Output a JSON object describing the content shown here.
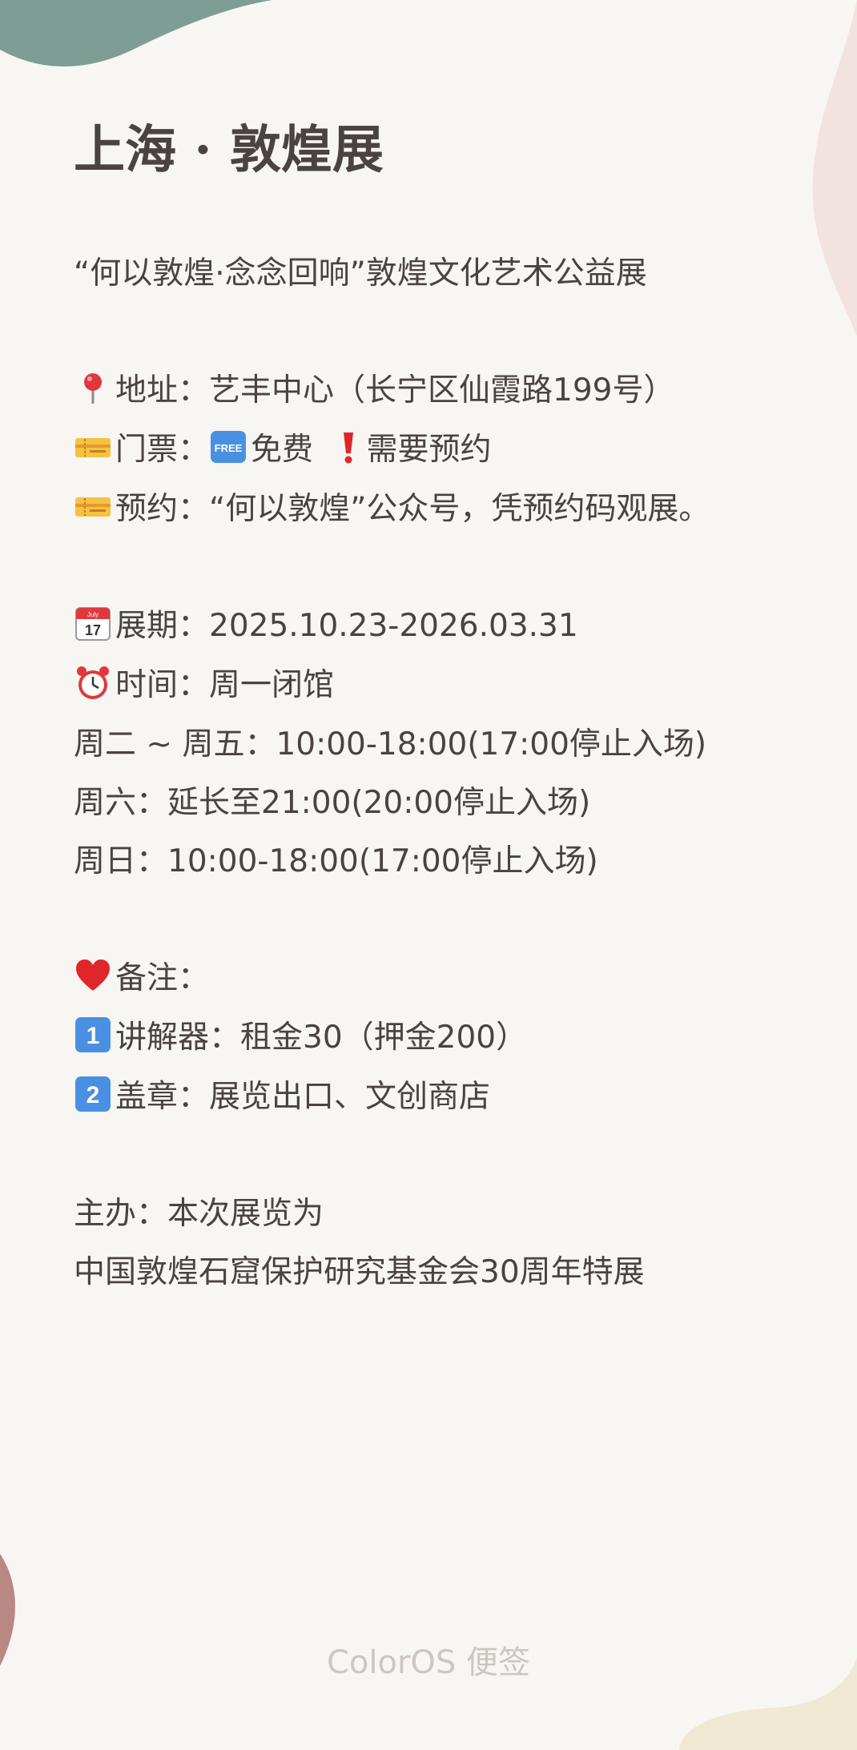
{
  "note": {
    "title": "上海 · 敦煌展",
    "subtitle": "“何以敦煌·念念回响”敦煌文化艺术公益展",
    "address": {
      "icon": "pin-icon",
      "text": "地址：艺丰中心（长宁区仙霞路199号）"
    },
    "ticket": {
      "icon": "ticket-icon",
      "label": "门票：",
      "free_icon": "free-icon",
      "free_text": "免费",
      "exclaim_icon": "exclamation-icon",
      "reserve_text": "需要预约"
    },
    "booking": {
      "icon": "ticket-icon",
      "text": "预约：“何以敦煌”公众号，凭预约码观展。"
    },
    "period": {
      "icon": "calendar-icon",
      "text": "展期：2025.10.23-2026.03.31"
    },
    "hours": {
      "icon": "alarm-clock-icon",
      "text": "时间：周一闭馆"
    },
    "hours_tue_fri": "周二 ~ 周五：10:00-18:00(17:00停止入场)",
    "hours_sat": "周六：延长至21:00(20:00停止入场)",
    "hours_sun": "周日：10:00-18:00(17:00停止入场)",
    "remarks": {
      "icon": "heart-icon",
      "text": "备注："
    },
    "remark_1": {
      "icon": "keycap-1-icon",
      "text": "讲解器：租金30（押金200）"
    },
    "remark_2": {
      "icon": "keycap-2-icon",
      "text": "盖章：展览出口、文创商店"
    },
    "organizer_1": "主办：本次展览为",
    "organizer_2": "中国敦煌石窟保护研究基金会30周年特展"
  },
  "footer": {
    "watermark": "ColorOS 便签"
  },
  "colors": {
    "background": "#f8f6f3",
    "text": "#4a4340",
    "footer_text": "#cdc6c1",
    "deco_teal": "#7e9d94",
    "deco_pink": "#f3e3e0",
    "deco_rose": "#b98784",
    "deco_cream": "#efe8d3"
  }
}
